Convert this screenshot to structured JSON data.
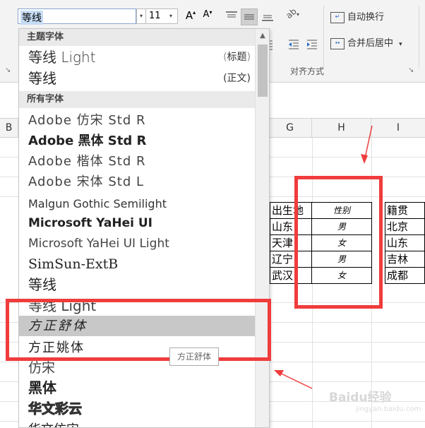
{
  "ribbon": {
    "font_name": "等线",
    "font_size": "11",
    "grow_font_label": "A",
    "shrink_font_label": "A",
    "wrap_text_label": "自动换行",
    "merge_center_label": "合并后居中",
    "merge_center_arrow": "▾",
    "alignment_group_label": "对齐方式",
    "dropdown_arrow": "▾",
    "orientation_icon": "ab",
    "launcher_icon": "↘"
  },
  "font_dropdown": {
    "theme_header": "主题字体",
    "all_header": "所有字体",
    "theme_fonts": [
      {
        "label": "等线 Light",
        "tag": "(标题)"
      },
      {
        "label": "等线",
        "tag": "(正文)"
      }
    ],
    "all_fonts": [
      "Adobe 仿宋 Std R",
      "Adobe 黑体 Std R",
      "Adobe 楷体 Std R",
      "Adobe 宋体 Std L",
      "Malgun Gothic Semilight",
      "Microsoft YaHei UI",
      "Microsoft YaHei UI Light",
      "SimSun-ExtB",
      "等线",
      "等线 Light",
      "方正舒体",
      "方正姚体",
      "仿宋",
      "黑体",
      "华文彩云",
      "华文仿宋"
    ],
    "selected": "方正舒体",
    "tooltip": "方正舒体"
  },
  "sheet": {
    "columns": [
      "B",
      "G",
      "H",
      "I"
    ],
    "headers": [
      "出生地",
      "性别",
      "籍贯"
    ],
    "rows": [
      [
        "山东",
        "男",
        "北京"
      ],
      [
        "天津",
        "女",
        "山东"
      ],
      [
        "辽宁",
        "男",
        "吉林"
      ],
      [
        "武汉",
        "女",
        "成都"
      ]
    ]
  },
  "watermark": {
    "text": "Baidu经验",
    "sub": "jingyan.baidu.com"
  },
  "colors": {
    "annotation_red": "#f03c3c",
    "selected_item_bg": "#c8c8c8",
    "ribbon_bg": "#f3f3f3"
  }
}
